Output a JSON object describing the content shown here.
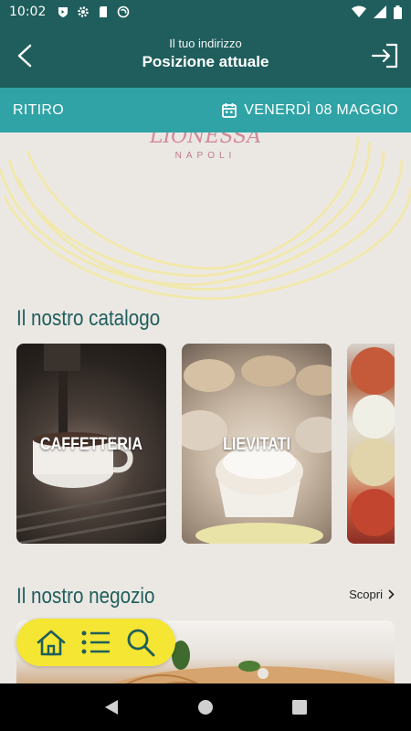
{
  "status_bar": {
    "time": "10:02"
  },
  "header": {
    "subtitle": "Il tuo indirizzo",
    "title": "Posizione attuale"
  },
  "subbar": {
    "mode": "RITIRO",
    "date": "VENERDÌ 08 MAGGIO"
  },
  "hero": {
    "brand": "LIONESSA",
    "city": "NAPOLI"
  },
  "catalog": {
    "title": "Il nostro catalogo",
    "cards": [
      {
        "label": "CAFFETTERIA"
      },
      {
        "label": "LIEVITATI"
      },
      {
        "label": ""
      }
    ]
  },
  "shop": {
    "title": "Il nostro negozio",
    "discover": "Scopri"
  },
  "colors": {
    "header": "#1f5e5c",
    "subbar": "#2fa3a6",
    "accent_yellow": "#f4e632",
    "background": "#ebe8e4"
  },
  "icons": [
    "back-arrow-icon",
    "login-icon",
    "calendar-icon",
    "home-icon",
    "list-icon",
    "search-icon",
    "chevron-right-icon"
  ]
}
